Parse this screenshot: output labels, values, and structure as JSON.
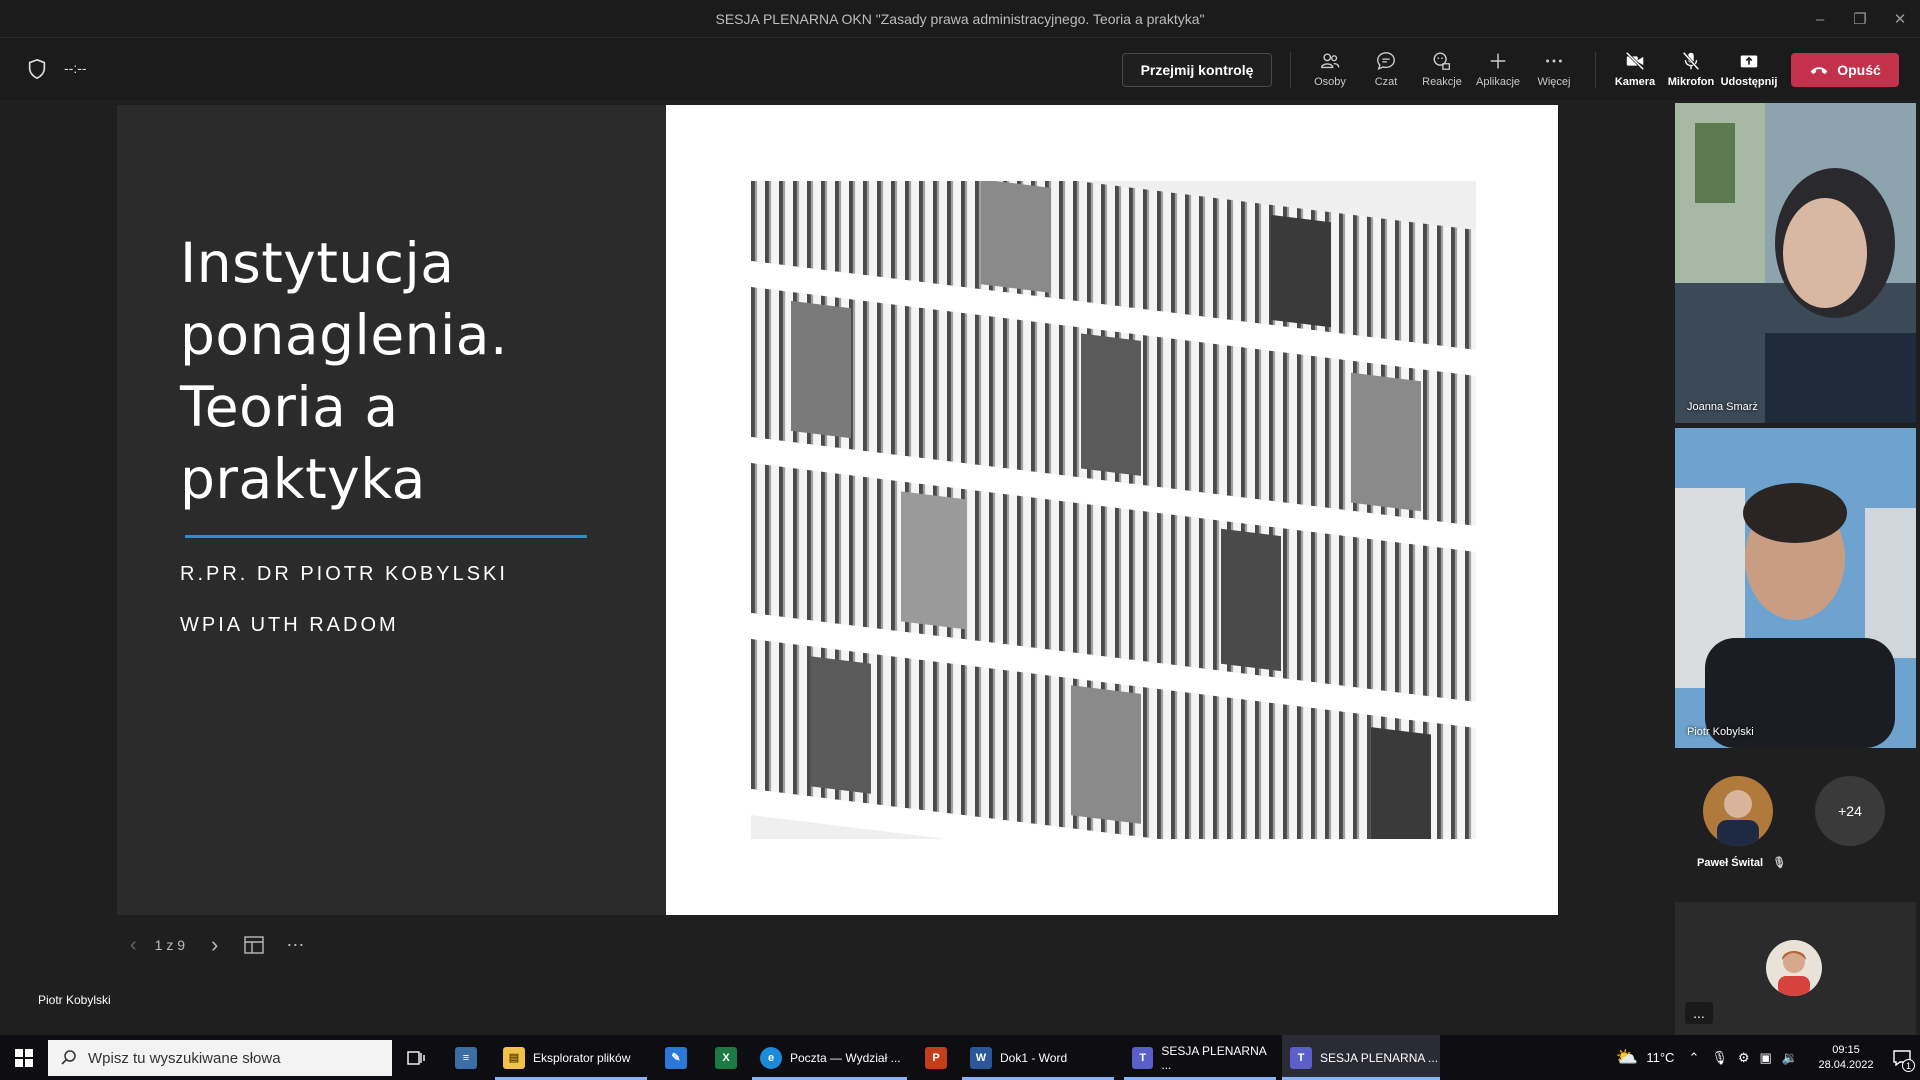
{
  "window": {
    "title": "SESJA PLENARNA OKN \"Zasady prawa administracyjnego. Teoria a praktyka\""
  },
  "toolbar": {
    "timer": "--:--",
    "take_control": "Przejmij kontrolę",
    "buttons": [
      {
        "label": "Osoby",
        "icon": "people-icon"
      },
      {
        "label": "Czat",
        "icon": "chat-icon"
      },
      {
        "label": "Reakcje",
        "icon": "reactions-icon"
      },
      {
        "label": "Aplikacje",
        "icon": "plus-icon"
      },
      {
        "label": "Więcej",
        "icon": "more-icon"
      },
      {
        "label": "Kamera",
        "icon": "camera-off-icon"
      },
      {
        "label": "Mikrofon",
        "icon": "mic-off-icon"
      },
      {
        "label": "Udostępnij",
        "icon": "share-icon"
      }
    ],
    "leave": "Opuść"
  },
  "slide": {
    "title_lines": [
      "Instytucja",
      "ponaglenia.",
      "Teoria a",
      "praktyka"
    ],
    "author": "R.PR. DR PIOTR KOBYLSKI",
    "affiliation": "WPIA UTH RADOM",
    "counter": "1 z 9"
  },
  "presenter": "Piotr Kobylski",
  "participants": {
    "tile1_name": "Joanna Smarż",
    "tile2_name": "Piotr Kobylski",
    "small1_name": "Paweł Śwital",
    "more_count": "+24",
    "more_button": "..."
  },
  "taskbar": {
    "search_placeholder": "Wpisz tu wyszukiwane słowa",
    "apps": [
      {
        "label": "Eksplorator plików"
      },
      {
        "label": "Poczta — Wydział ..."
      },
      {
        "label": "Dok1 - Word"
      },
      {
        "label": "SESJA PLENARNA ..."
      },
      {
        "label": "SESJA PLENARNA ..."
      }
    ],
    "temperature": "11°C",
    "time": "09:15",
    "date": "28.04.2022",
    "notifications": "1"
  },
  "colors": {
    "leave": "#c4314b",
    "accent_line": "#2d8fc6",
    "teams": "#5b5fc7"
  }
}
